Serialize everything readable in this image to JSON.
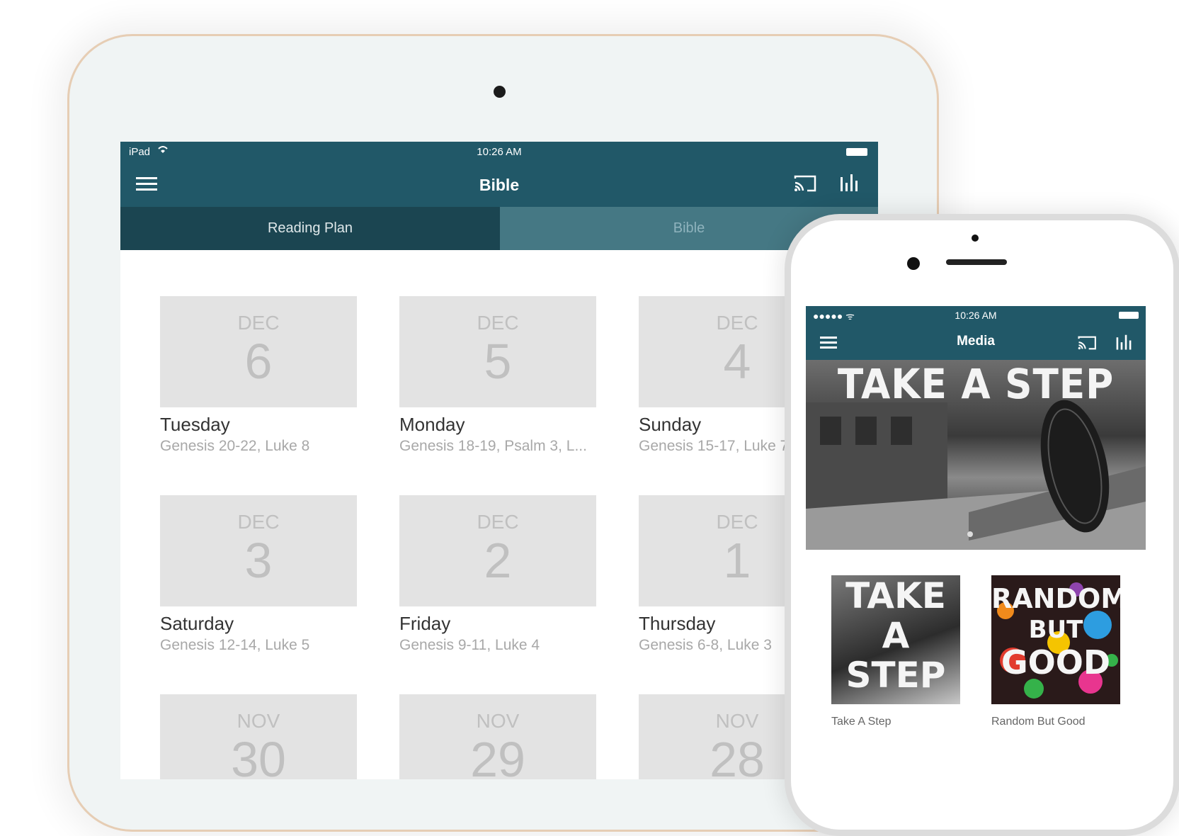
{
  "ipad": {
    "status": {
      "left": "iPad",
      "time": "10:26 AM"
    },
    "nav": {
      "title": "Bible"
    },
    "tabs": [
      {
        "label": "Reading Plan"
      },
      {
        "label": "Bible"
      }
    ],
    "cards": [
      {
        "month": "DEC",
        "day": "6",
        "dow": "Tuesday",
        "ref": "Genesis 20-22, Luke 8"
      },
      {
        "month": "DEC",
        "day": "5",
        "dow": "Monday",
        "ref": "Genesis 18-19, Psalm 3, L..."
      },
      {
        "month": "DEC",
        "day": "4",
        "dow": "Sunday",
        "ref": "Genesis 15-17, Luke 7"
      },
      {
        "month": "DEC",
        "day": "3",
        "dow": "Saturday",
        "ref": "Genesis 12-14, Luke 5"
      },
      {
        "month": "DEC",
        "day": "2",
        "dow": "Friday",
        "ref": "Genesis 9-11, Luke 4"
      },
      {
        "month": "DEC",
        "day": "1",
        "dow": "Thursday",
        "ref": "Genesis 6-8, Luke 3"
      },
      {
        "month": "NOV",
        "day": "30",
        "dow": "",
        "ref": ""
      },
      {
        "month": "NOV",
        "day": "29",
        "dow": "",
        "ref": ""
      },
      {
        "month": "NOV",
        "day": "28",
        "dow": "",
        "ref": ""
      }
    ]
  },
  "iphone": {
    "status": {
      "left": "●●●●● ᯤ",
      "time": "10:26 AM"
    },
    "nav": {
      "title": "Media"
    },
    "hero": {
      "title": "TAKE A STEP"
    },
    "tiles": [
      {
        "art_lines": [
          "TAKE",
          "A",
          "STEP"
        ],
        "caption": "Take A Step"
      },
      {
        "art_lines": [
          "RANDOM",
          "BUT",
          "GOOD"
        ],
        "caption": "Random But Good"
      }
    ]
  },
  "colors": {
    "nav": "#215868",
    "tab_active": "#1b4551",
    "tab_inactive": "#457884",
    "card": "#e3e3e3"
  },
  "icons": [
    "menu-icon",
    "cast-icon",
    "stats-icon",
    "wifi-icon",
    "battery-icon"
  ]
}
